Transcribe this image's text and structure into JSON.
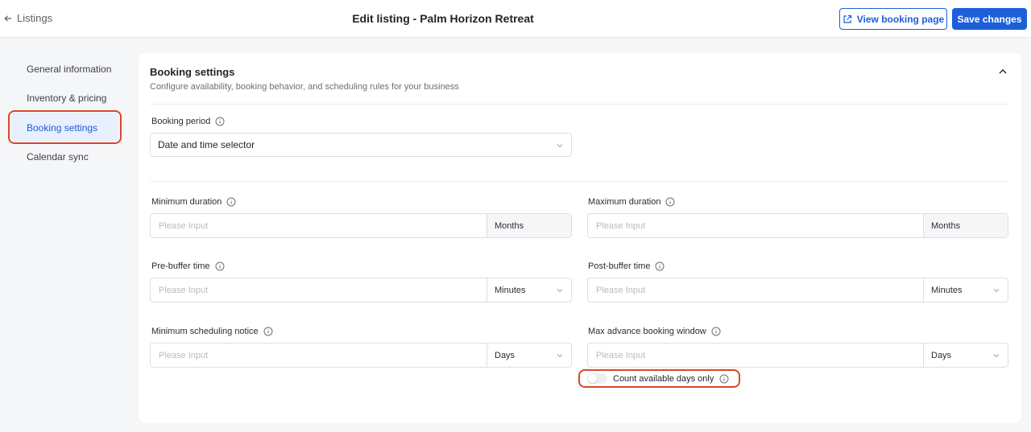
{
  "header": {
    "back_label": "Listings",
    "title": "Edit listing - Palm Horizon Retreat",
    "view_booking_label": "View booking page",
    "save_label": "Save changes"
  },
  "sidebar": {
    "items": [
      {
        "label": "General information"
      },
      {
        "label": "Inventory & pricing"
      },
      {
        "label": "Booking settings"
      },
      {
        "label": "Calendar sync"
      }
    ],
    "active_index": 2
  },
  "card": {
    "title": "Booking settings",
    "subtitle": "Configure availability, booking behavior, and scheduling rules for your business"
  },
  "fields": {
    "booking_period": {
      "label": "Booking period",
      "value": "Date and time selector"
    },
    "minimum_duration": {
      "label": "Minimum duration",
      "placeholder": "Please Input",
      "unit": "Months"
    },
    "maximum_duration": {
      "label": "Maximum duration",
      "placeholder": "Please Input",
      "unit": "Months"
    },
    "pre_buffer": {
      "label": "Pre-buffer time",
      "placeholder": "Please Input",
      "unit": "Minutes"
    },
    "post_buffer": {
      "label": "Post-buffer time",
      "placeholder": "Please Input",
      "unit": "Minutes"
    },
    "min_notice": {
      "label": "Minimum scheduling notice",
      "placeholder": "Please Input",
      "unit": "Days"
    },
    "max_window": {
      "label": "Max advance booking window",
      "placeholder": "Please Input",
      "unit": "Days"
    }
  },
  "toggle": {
    "label": "Count available days only",
    "enabled": false
  },
  "colors": {
    "accent": "#1c5fd8",
    "highlight": "#d9472b"
  },
  "icons": {
    "back": "arrow-left-icon",
    "external": "external-link-icon",
    "collapse": "chevron-up-icon",
    "info": "info-icon",
    "dropdown": "chevron-down-icon"
  }
}
